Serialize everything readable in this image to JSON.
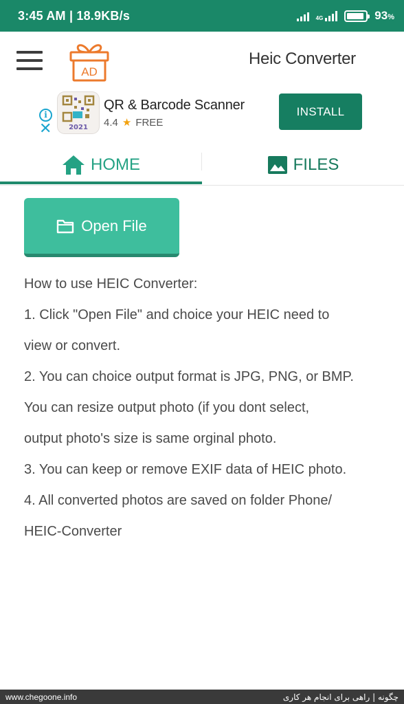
{
  "status_bar": {
    "time_speed": "3:45 AM | 18.9KB/s",
    "network_label": "4G",
    "battery_percent": "93",
    "battery_unit": "%",
    "battery_level": 0.93
  },
  "app_bar": {
    "title": "Heic Converter",
    "ad_icon_text": "AD"
  },
  "ad_banner": {
    "app_name": "QR & Barcode Scanner",
    "rating": "4.4",
    "price": "FREE",
    "install_label": "INSTALL",
    "icon_text": "2021"
  },
  "tabs": [
    {
      "label": "HOME",
      "icon": "home-icon",
      "active": true
    },
    {
      "label": "FILES",
      "icon": "image-icon",
      "active": false
    }
  ],
  "main": {
    "open_file_label": "Open File",
    "instructions": [
      "How to use HEIC Converter:",
      "1. Click \"Open File\" and choice your HEIC need to",
      "view or convert.",
      "2. You can choice output format is JPG, PNG, or BMP.",
      "You can resize output photo (if you dont select,",
      "output photo's size is same orginal photo.",
      "3. You can keep or remove EXIF data of HEIC photo.",
      "4. All converted photos are saved on folder Phone/",
      "HEIC-Converter"
    ]
  },
  "footer": {
    "left": "www.chegoone.info",
    "right": "چگونه | راهی برای انجام هر کاری"
  },
  "colors": {
    "status_bar": "#1a8868",
    "accent": "#25a284",
    "install_button": "#167e61",
    "open_button": "#3ebe9d",
    "ad_orange": "#ec7a2c"
  }
}
